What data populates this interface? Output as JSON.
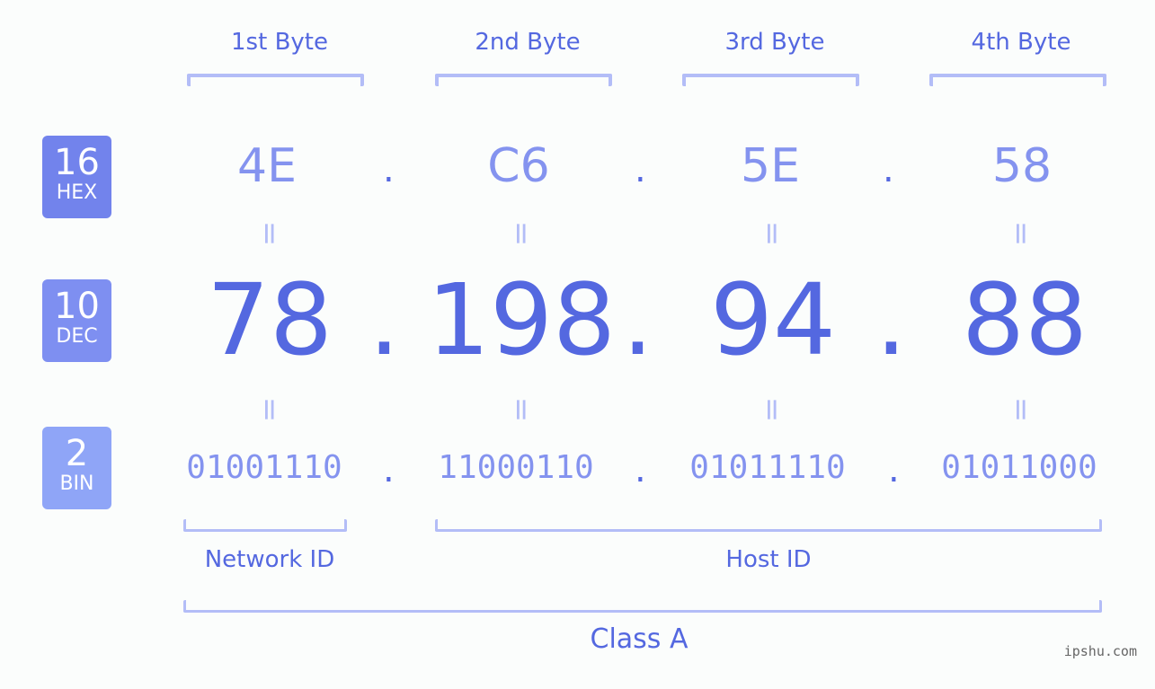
{
  "bytes": [
    {
      "label": "1st Byte",
      "hex": "4E",
      "dec": "78",
      "bin": "01001110"
    },
    {
      "label": "2nd Byte",
      "hex": "C6",
      "dec": "198",
      "bin": "11000110"
    },
    {
      "label": "3rd Byte",
      "hex": "5E",
      "dec": "94",
      "bin": "01011110"
    },
    {
      "label": "4th Byte",
      "hex": "58",
      "dec": "88",
      "bin": "01011000"
    }
  ],
  "badges": {
    "hex": {
      "num": "16",
      "label": "HEX",
      "color": "#7283ec"
    },
    "dec": {
      "num": "10",
      "label": "DEC",
      "color": "#7e8ff1"
    },
    "bin": {
      "num": "2",
      "label": "BIN",
      "color": "#8fa5f7"
    }
  },
  "separator": ".",
  "equals": "=",
  "network_id": "Network ID",
  "host_id": "Host ID",
  "class_label": "Class A",
  "watermark": "ipshu.com"
}
